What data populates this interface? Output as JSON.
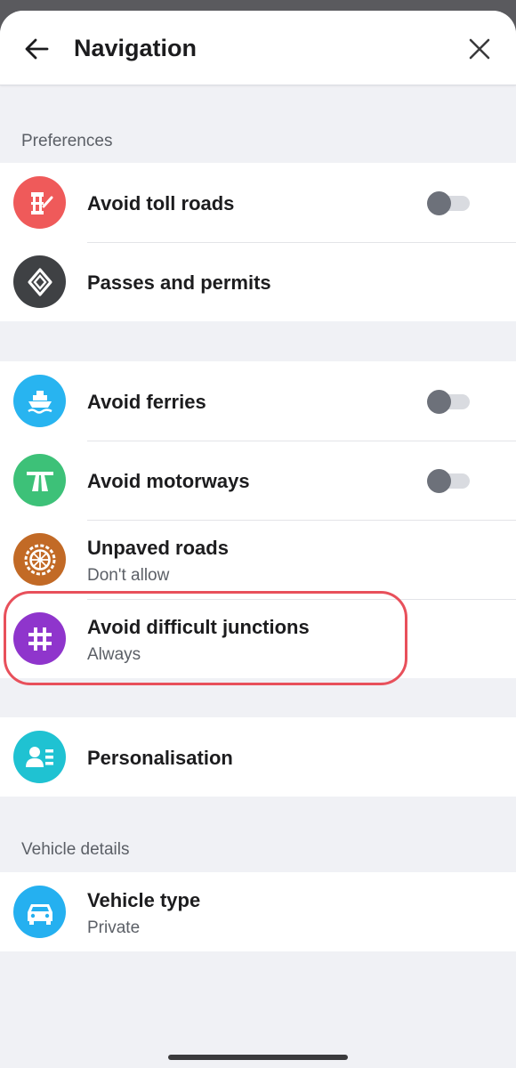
{
  "header": {
    "title": "Navigation",
    "back_icon": "arrow-left-icon",
    "close_icon": "close-icon"
  },
  "sections": {
    "preferences_label": "Preferences",
    "vehicle_label": "Vehicle details"
  },
  "preferences": {
    "toll": {
      "label": "Avoid toll roads",
      "toggle_on": false,
      "icon": "toll-gate-icon",
      "color": "#ef5a5a"
    },
    "passes": {
      "label": "Passes and permits",
      "icon": "diamond-icon",
      "color": "#3f4144"
    }
  },
  "avoid": {
    "ferries": {
      "label": "Avoid ferries",
      "toggle_on": false,
      "icon": "ferry-icon",
      "color": "#28b4f0"
    },
    "motorways": {
      "label": "Avoid motorways",
      "toggle_on": false,
      "icon": "motorway-icon",
      "color": "#3dc178"
    },
    "unpaved": {
      "label": "Unpaved roads",
      "value": "Don't allow",
      "icon": "wheel-icon",
      "color": "#c26a26"
    },
    "junctions": {
      "label": "Avoid difficult junctions",
      "value": "Always",
      "icon": "junction-icon",
      "color": "#8f35cc"
    }
  },
  "personalisation": {
    "label": "Personalisation",
    "icon": "profile-list-icon",
    "color": "#1fc2d2"
  },
  "vehicle": {
    "label": "Vehicle type",
    "value": "Private",
    "icon": "car-icon",
    "color": "#25b0f0"
  },
  "highlight_color": "#e8505b"
}
